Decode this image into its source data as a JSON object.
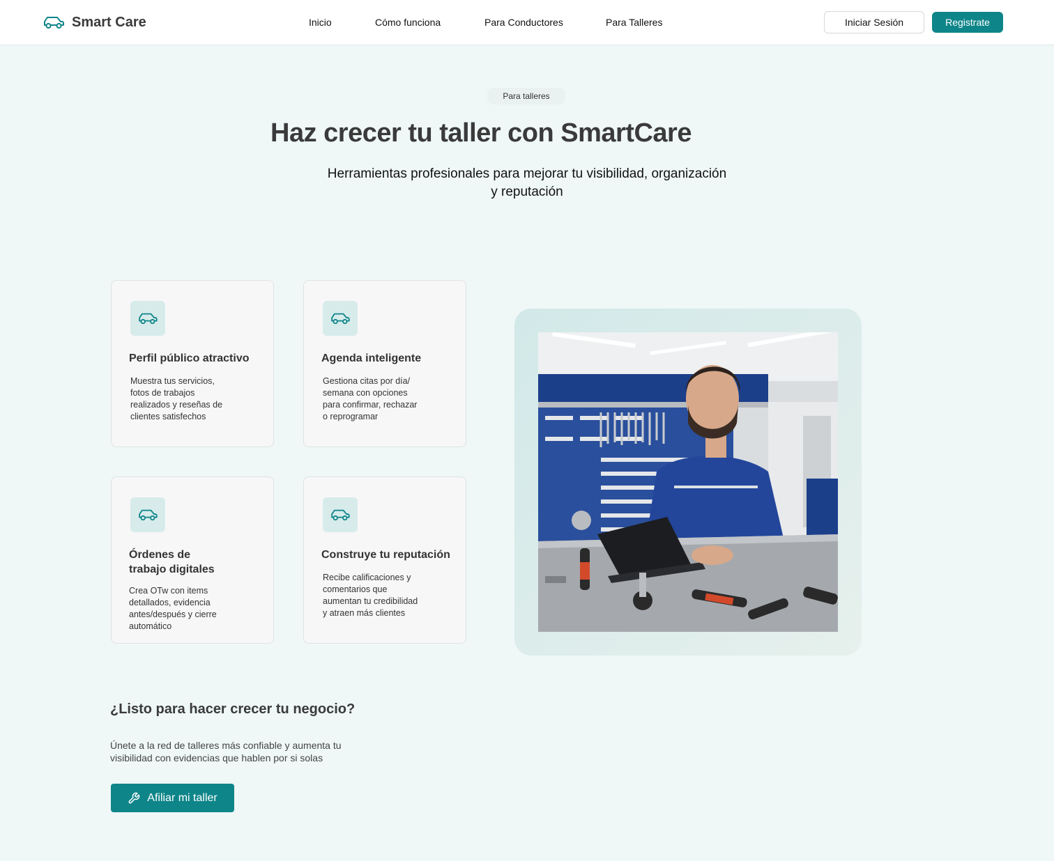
{
  "brand": {
    "name": "Smart Care",
    "icon": "car-icon"
  },
  "nav": {
    "items": [
      {
        "label": "Inicio"
      },
      {
        "label": "Cómo funciona"
      },
      {
        "label": "Para Conductores"
      },
      {
        "label": "Para Talleres"
      }
    ],
    "login_label": "Iniciar Sesión",
    "register_label": "Registrate"
  },
  "hero": {
    "badge": "Para talleres",
    "title": "Haz crecer tu taller con SmartCare",
    "subtitle_line1": "Herramientas profesionales para mejorar tu visibilidad, organización",
    "subtitle_line2": "y reputación"
  },
  "features": [
    {
      "icon": "car-icon",
      "title": "Perfil público atractivo",
      "desc": [
        "Muestra tus servicios,",
        "fotos de trabajos",
        "realizados y reseñas de",
        "clientes satisfechos"
      ]
    },
    {
      "icon": "car-icon",
      "title": "Agenda inteligente",
      "desc": [
        "Gestiona citas por día/",
        "semana con opciones",
        "para confirmar, rechazar",
        "o reprogramar"
      ]
    },
    {
      "icon": "car-icon",
      "title": "Órdenes de trabajo digitales",
      "title_line1": "Órdenes de",
      "title_line2": "trabajo digitales",
      "desc": [
        "Crea OTw con items",
        "detallados, evidencia",
        "antes/después y cierre",
        "automático"
      ]
    },
    {
      "icon": "car-icon",
      "title": "Construye tu reputación",
      "desc": [
        "Recibe calificaciones y",
        "comentarios que",
        "aumentan tu credibilidad",
        "y atraen más clientes"
      ]
    }
  ],
  "cta": {
    "title": "¿Listo para hacer crecer tu negocio?",
    "text_line1": "Únete a la red de talleres más confiable y aumenta tu",
    "text_line2": "visibilidad con evidencias que hablen por si solas",
    "button_label": "Afiliar mi taller",
    "button_icon": "wrench-icon"
  },
  "colors": {
    "accent": "#0e8589",
    "background": "#eff7f7",
    "card": "#f7f7f7",
    "icon_tile": "#d7ebeb"
  }
}
